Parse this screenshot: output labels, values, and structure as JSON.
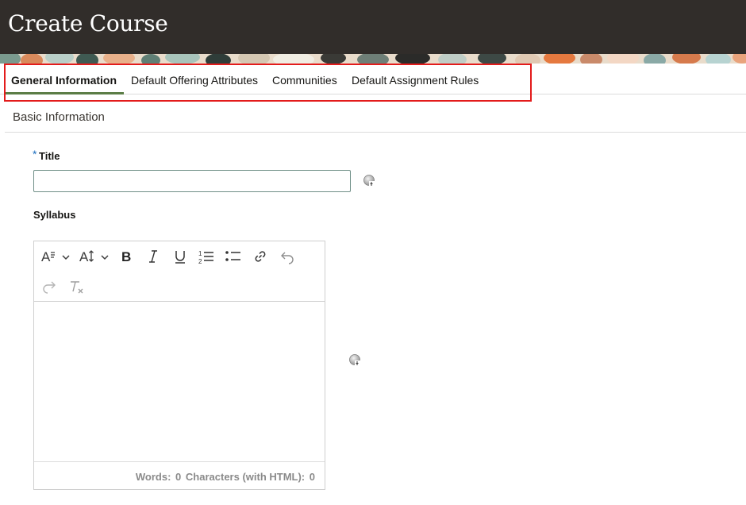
{
  "page": {
    "title": "Create Course"
  },
  "tabs": [
    {
      "label": "General Information",
      "active": true
    },
    {
      "label": "Default Offering Attributes",
      "active": false
    },
    {
      "label": "Communities",
      "active": false
    },
    {
      "label": "Default Assignment Rules",
      "active": false
    }
  ],
  "section": {
    "title": "Basic Information"
  },
  "form": {
    "title": {
      "required_mark": "*",
      "label": "Title",
      "value": "",
      "help_icon": "help-icon"
    },
    "syllabus": {
      "label": "Syllabus",
      "help_icon": "help-icon"
    }
  },
  "editor": {
    "toolbar": [
      {
        "name": "font-style-icon",
        "glyph": "A≡",
        "dropdown": true
      },
      {
        "name": "font-size-icon",
        "glyph": "A↕",
        "dropdown": true
      },
      {
        "name": "bold-icon",
        "glyph": "B"
      },
      {
        "name": "italic-icon",
        "glyph": "I"
      },
      {
        "name": "underline-icon",
        "glyph": "U"
      },
      {
        "name": "numbered-list-icon",
        "glyph": "1≡"
      },
      {
        "name": "bullet-list-icon",
        "glyph": "•≡"
      },
      {
        "name": "link-icon",
        "glyph": "🔗"
      },
      {
        "name": "undo-icon",
        "glyph": "↶",
        "disabled": true
      },
      {
        "name": "redo-icon",
        "glyph": "↷",
        "disabled": true
      },
      {
        "name": "clear-formatting-icon",
        "glyph": "Tx",
        "disabled": true
      }
    ],
    "words_label": "Words:",
    "words_value": "0",
    "chars_label": "Characters (with HTML):",
    "chars_value": "0"
  },
  "colors": {
    "header_bg": "#312d2a",
    "active_tab_underline": "#5b7d46",
    "highlight_border": "#e31b1b",
    "required_star": "#1e6fbf"
  }
}
